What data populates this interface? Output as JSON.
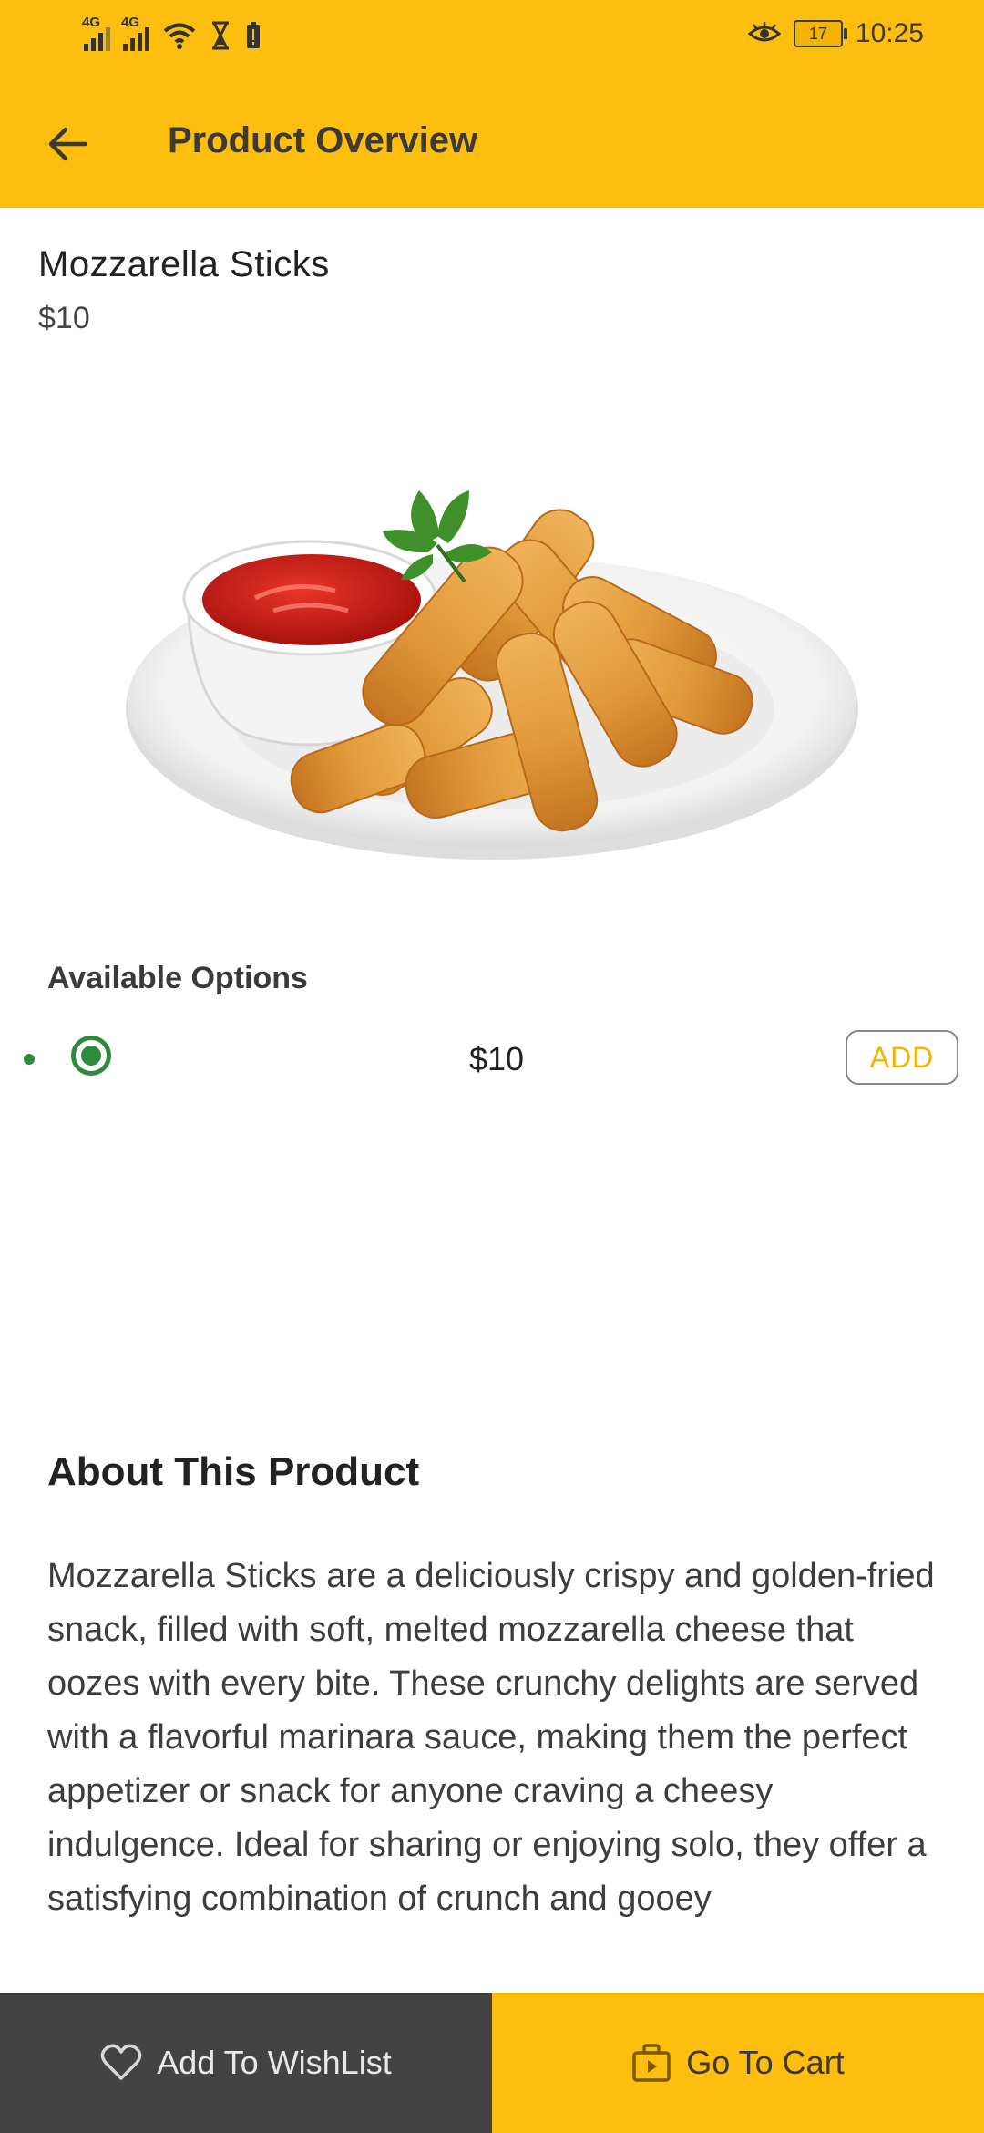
{
  "status_bar": {
    "net1": "4G",
    "net2": "4G",
    "battery": "17",
    "time": "10:25"
  },
  "header": {
    "title": "Product Overview"
  },
  "product": {
    "name": "Mozzarella Sticks",
    "price": "$10",
    "image_icon": "mozzarella-sticks-plate-image"
  },
  "options": {
    "title": "Available Options",
    "items": [
      {
        "price": "$10",
        "selected": true,
        "add_label": "ADD"
      }
    ]
  },
  "about": {
    "title": "About This Product",
    "text": "Mozzarella Sticks are a deliciously crispy and golden-fried snack, filled with soft, melted mozzarella cheese that oozes with every bite. These crunchy delights are served with a flavorful marinara sauce, making them the perfect appetizer or snack for anyone craving a cheesy indulgence. Ideal for sharing or enjoying solo, they offer a satisfying combination of crunch and gooey"
  },
  "bottom_bar": {
    "wishlist_label": "Add To WishList",
    "cart_label": "Go To Cart"
  },
  "colors": {
    "brand_yellow": "#FDBE10",
    "dark_gray": "#434343",
    "selected_green": "#2e8b3e",
    "add_text": "#F2B400"
  }
}
